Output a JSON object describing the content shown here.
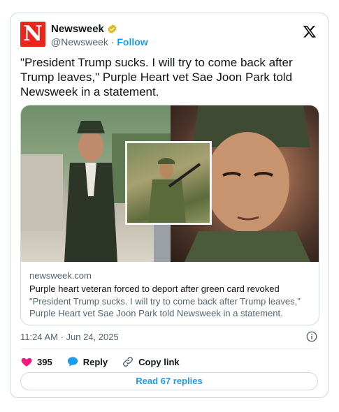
{
  "account": {
    "logo_letter": "N",
    "name": "Newsweek",
    "handle": "@Newsweek",
    "separator": " · ",
    "follow_label": "Follow",
    "brand_color": "#e8261c",
    "verified_color": "#e2b719"
  },
  "tweet": {
    "text": "\"President Trump sucks. I will try to come back after Trump leaves,\" Purple Heart vet Sae Joon Park told Newsweek in a statement.",
    "timestamp": "11:24 AM · Jun 24, 2025"
  },
  "link_card": {
    "domain": "newsweek.com",
    "title": "Purple heart veteran forced to deport after green card revoked",
    "description": "\"President Trump sucks. I will try to come back after Trump leaves,\" Purple Heart vet Sae Joon Park told Newsweek in a statement."
  },
  "actions": {
    "like_count": "395",
    "reply_label": "Reply",
    "copy_link_label": "Copy link",
    "like_color": "#f91880",
    "reply_color": "#1d9bf0"
  },
  "replies_button": {
    "label": "Read 67 replies"
  },
  "icons": [
    "verified-badge-icon",
    "x-logo-icon",
    "info-icon",
    "heart-icon",
    "reply-bubble-icon",
    "link-icon"
  ]
}
